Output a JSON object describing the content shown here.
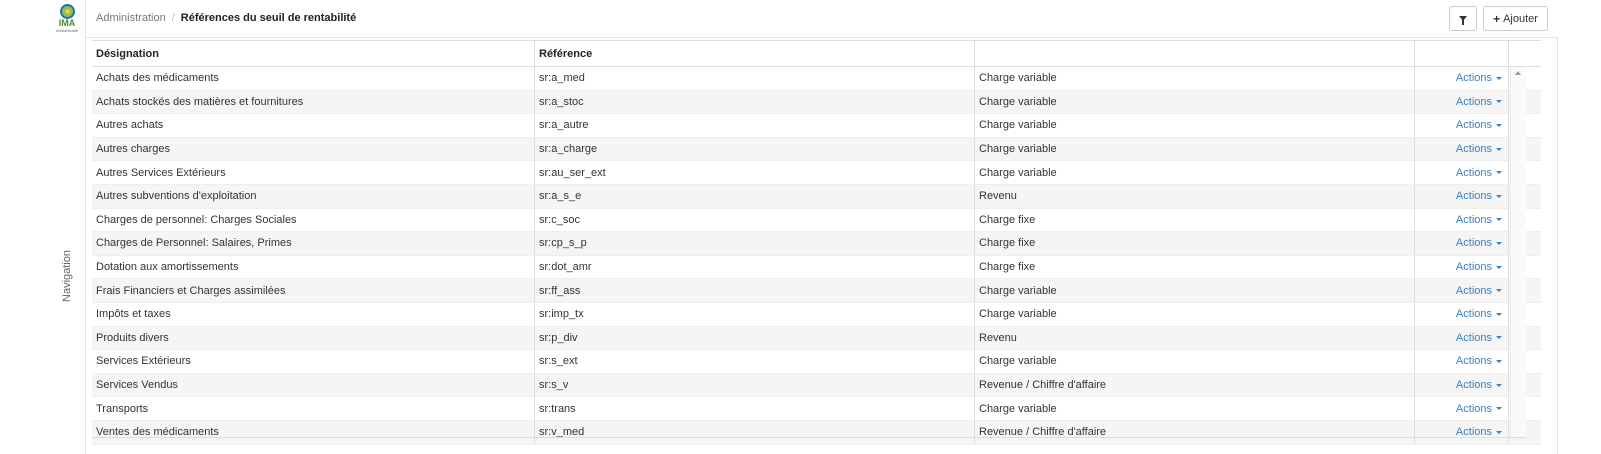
{
  "logo": {
    "text": "IMA",
    "subtext": "WorldHealth"
  },
  "breadcrumb": {
    "root": "Administration",
    "separator": "/",
    "current": "Références du seuil de rentabilité"
  },
  "toolbar": {
    "add_label": "Ajouter",
    "add_prefix": "+"
  },
  "nav": {
    "label": "Navigation"
  },
  "table": {
    "headers": [
      "Désignation",
      "Référence",
      "",
      ""
    ],
    "actions_label": "Actions",
    "rows": [
      [
        "Achats des médicaments",
        "sr:a_med",
        "Charge variable"
      ],
      [
        "Achats stockés des matières et fournitures",
        "sr:a_stoc",
        "Charge variable"
      ],
      [
        "Autres achats",
        "sr:a_autre",
        "Charge variable"
      ],
      [
        "Autres charges",
        "sr:a_charge",
        "Charge variable"
      ],
      [
        "Autres Services Extérieurs",
        "sr:au_ser_ext",
        "Charge variable"
      ],
      [
        "Autres subventions d'exploitation",
        "sr:a_s_e",
        "Revenu"
      ],
      [
        "Charges de personnel: Charges Sociales",
        "sr:c_soc",
        "Charge fixe"
      ],
      [
        "Charges de Personnel: Salaires, Primes",
        "sr:cp_s_p",
        "Charge fixe"
      ],
      [
        "Dotation aux amortissements",
        "sr:dot_amr",
        "Charge fixe"
      ],
      [
        "Frais Financiers et Charges assimilées",
        "sr:ff_ass",
        "Charge variable"
      ],
      [
        "Impôts et taxes",
        "sr:imp_tx",
        "Charge variable"
      ],
      [
        "Produits divers",
        "sr:p_div",
        "Revenu"
      ],
      [
        "Services Extérieurs",
        "sr:s_ext",
        "Charge variable"
      ],
      [
        "Services Vendus",
        "sr:s_v",
        "Revenue / Chiffre d'affaire"
      ],
      [
        "Transports",
        "sr:trans",
        "Charge variable"
      ],
      [
        "Ventes des médicaments",
        "sr:v_med",
        "Revenue / Chiffre d'affaire"
      ]
    ]
  },
  "colors": {
    "link": "#3a7fc1",
    "stripe": "#f5f5f5",
    "border": "#dddddd"
  }
}
